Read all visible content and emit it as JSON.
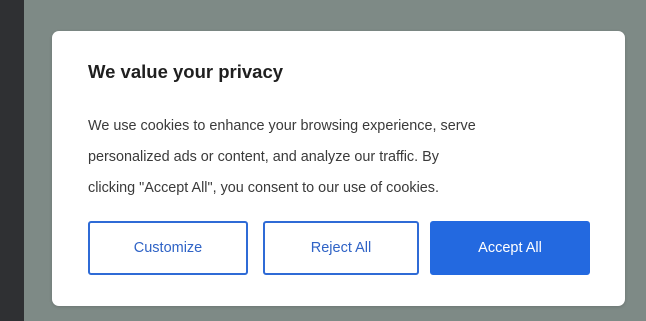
{
  "cookie_dialog": {
    "title": "We value your privacy",
    "body_lines": [
      "We use cookies to enhance your browsing experience, serve",
      "personalized ads or content, and analyze our traffic. By",
      "clicking \"Accept All\", you consent to our use of cookies."
    ],
    "buttons": {
      "customize": "Customize",
      "reject_all": "Reject All",
      "accept_all": "Accept All"
    }
  },
  "colors": {
    "accent": "#2369e0",
    "overlay": "#7e8a86",
    "backdrop": "#2f3033"
  }
}
